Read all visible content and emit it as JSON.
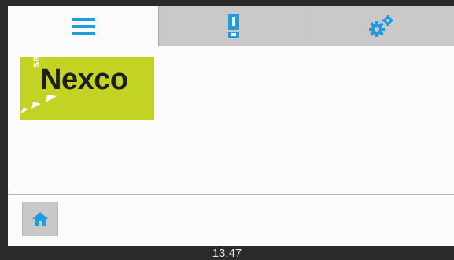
{
  "tabs": [
    {
      "name": "menu",
      "icon": "hamburger-menu-icon",
      "active": true
    },
    {
      "name": "alarm",
      "icon": "exclamation-alert-icon",
      "active": false
    },
    {
      "name": "settings",
      "icon": "gears-icon",
      "active": false
    }
  ],
  "logo": {
    "prefix": "SR",
    "name": "Nexco"
  },
  "footer": {
    "home_icon": "home-icon"
  },
  "status": {
    "time": "13:47"
  },
  "colors": {
    "accent": "#1f9be0",
    "logo_bg": "#c3d323",
    "tab_inactive": "#c9c9c9"
  }
}
